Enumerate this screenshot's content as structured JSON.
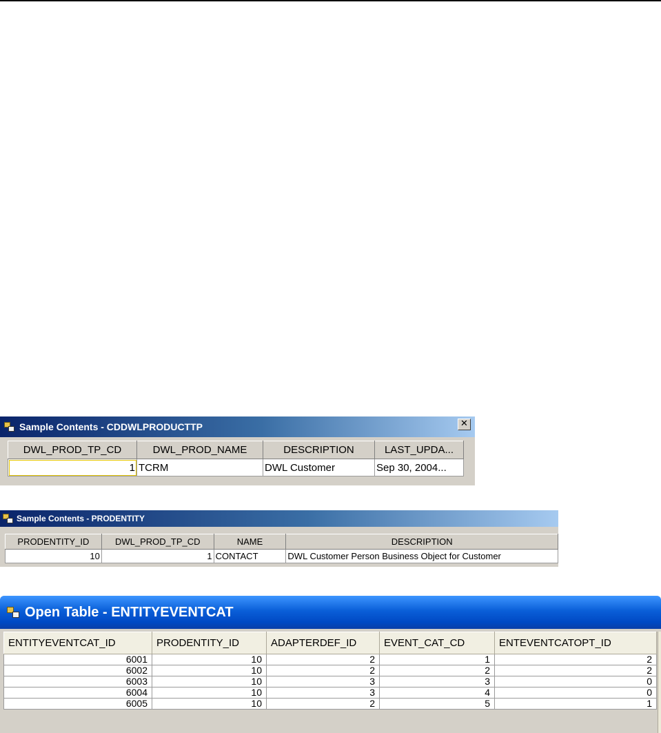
{
  "window1": {
    "title": "Sample Contents - CDDWLPRODUCTTP",
    "close_label": "✕",
    "columns": [
      "DWL_PROD_TP_CD",
      "DWL_PROD_NAME",
      "DESCRIPTION",
      "LAST_UPDA..."
    ],
    "rows": [
      [
        "1",
        "TCRM",
        "DWL Customer",
        "Sep 30, 2004..."
      ]
    ]
  },
  "window2": {
    "title": "Sample Contents - PRODENTITY",
    "columns": [
      "PRODENTITY_ID",
      "DWL_PROD_TP_CD",
      "NAME",
      "DESCRIPTION"
    ],
    "rows": [
      [
        "10",
        "1",
        "CONTACT",
        "DWL Customer Person Business Object for Customer"
      ]
    ]
  },
  "window3": {
    "title": "Open Table - ENTITYEVENTCAT",
    "columns": [
      "ENTITYEVENTCAT_ID",
      "PRODENTITY_ID",
      "ADAPTERDEF_ID",
      "EVENT_CAT_CD",
      "ENTEVENTCATOPT_ID"
    ],
    "rows": [
      [
        "6001",
        "10",
        "2",
        "1",
        "2"
      ],
      [
        "6002",
        "10",
        "2",
        "2",
        "2"
      ],
      [
        "6003",
        "10",
        "3",
        "3",
        "0"
      ],
      [
        "6004",
        "10",
        "3",
        "4",
        "0"
      ],
      [
        "6005",
        "10",
        "2",
        "5",
        "1"
      ]
    ]
  }
}
